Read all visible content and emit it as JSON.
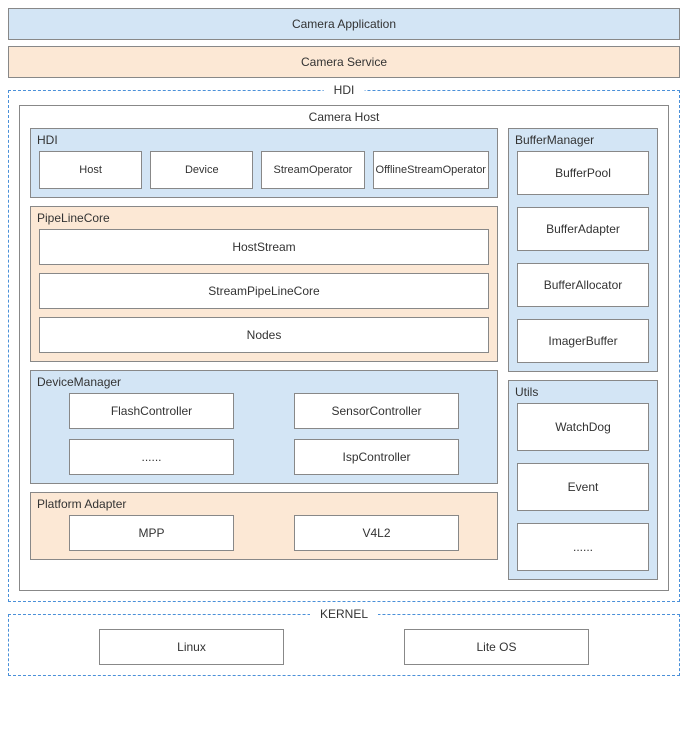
{
  "top": {
    "app": "Camera Application",
    "service": "Camera Service"
  },
  "hdi_section_label": "HDI",
  "camera_host_label": "Camera Host",
  "hdi_group": {
    "label": "HDI",
    "items": [
      "Host",
      "Device",
      "StreamOperator",
      "OfflineStreamOperator"
    ]
  },
  "pipeline": {
    "label": "PipeLineCore",
    "items": [
      "HostStream",
      "StreamPipeLineCore",
      "Nodes"
    ]
  },
  "device_manager": {
    "label": "DeviceManager",
    "items": [
      "FlashController",
      "SensorController",
      "......",
      "IspController"
    ]
  },
  "platform_adapter": {
    "label": "Platform Adapter",
    "items": [
      "MPP",
      "V4L2"
    ]
  },
  "buffer_manager": {
    "label": "BufferManager",
    "items": [
      "BufferPool",
      "BufferAdapter",
      "BufferAllocator",
      "ImagerBuffer"
    ]
  },
  "utils": {
    "label": "Utils",
    "items": [
      "WatchDog",
      "Event",
      "......"
    ]
  },
  "kernel": {
    "label": "KERNEL",
    "items": [
      "Linux",
      "Lite OS"
    ]
  }
}
